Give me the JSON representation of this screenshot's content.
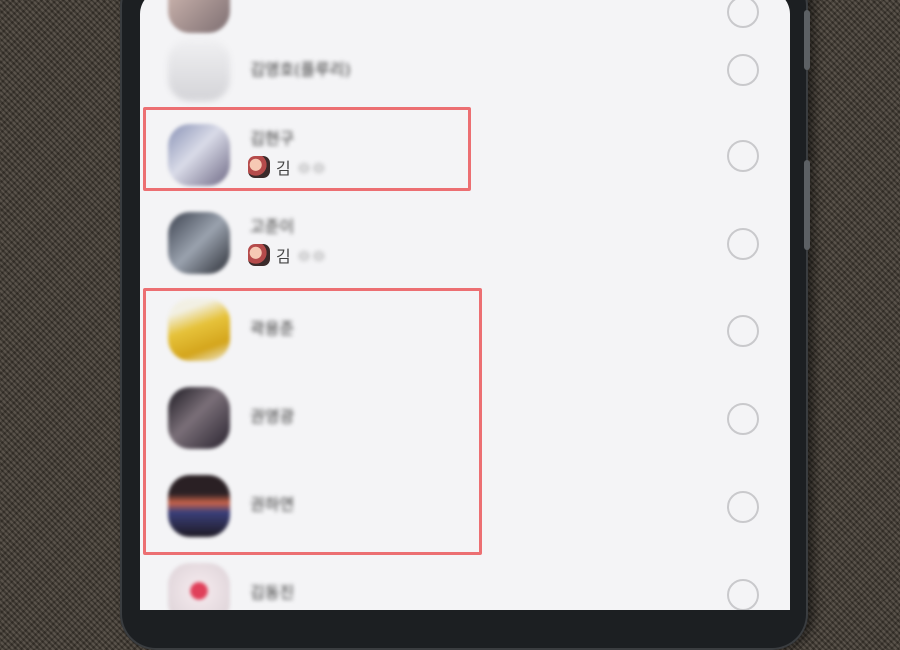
{
  "contacts": [
    {
      "name": "김영호(플루리)",
      "sub_initial": "",
      "sub_rest": "",
      "has_sub": false,
      "selected": false
    },
    {
      "name": "김현구",
      "sub_initial": "김",
      "sub_rest": "ㅇㅇ",
      "has_sub": true,
      "selected": false
    },
    {
      "name": "고준이",
      "sub_initial": "김",
      "sub_rest": "ㅇㅇ",
      "has_sub": true,
      "selected": false
    },
    {
      "name": "곽용준",
      "sub_initial": "",
      "sub_rest": "",
      "has_sub": false,
      "selected": false
    },
    {
      "name": "권영광",
      "sub_initial": "",
      "sub_rest": "",
      "has_sub": false,
      "selected": false
    },
    {
      "name": "권하연",
      "sub_initial": "",
      "sub_rest": "",
      "has_sub": false,
      "selected": false
    },
    {
      "name": "김동진",
      "sub_initial": "",
      "sub_rest": "",
      "has_sub": false,
      "selected": false
    }
  ],
  "colors": {
    "highlight": "#ec6f72",
    "radio_border": "#c9c9cc",
    "screen_bg": "#f4f4f6"
  }
}
